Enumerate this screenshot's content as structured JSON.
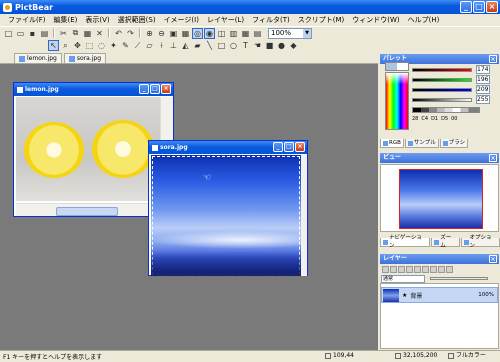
{
  "app": {
    "title": "PictBear"
  },
  "menu": [
    "ファイル(F)",
    "編集(E)",
    "表示(V)",
    "選択範囲(S)",
    "イメージ(I)",
    "レイヤー(L)",
    "フィルタ(T)",
    "スクリプト(M)",
    "ウィンドウ(W)",
    "ヘルプ(H)"
  ],
  "toolbar": {
    "zoom_value": "100%"
  },
  "tabs": [
    {
      "label": "lemon.jpg"
    },
    {
      "label": "sora.jpg"
    }
  ],
  "windows": {
    "lemon": {
      "title": "lemon.jpg"
    },
    "sora": {
      "title": "sora.jpg"
    }
  },
  "status": {
    "help_text": "F1 キーを押すとヘルプを表示します",
    "position": "109,44",
    "size": "32,105,200",
    "color_mode": "フルカラー"
  },
  "palette": {
    "title": "パレット",
    "rgb_values": [
      "174",
      "196",
      "209",
      "255"
    ],
    "hex_row": [
      "28",
      "C4",
      "D1",
      "D5",
      "00"
    ],
    "tabs": [
      "RGB",
      "サンプル",
      "ブラシ"
    ],
    "fg_color": "#aec4de"
  },
  "navigator": {
    "title": "ビュー",
    "tabs": [
      "ナビゲーション",
      "ズーム",
      "オプション"
    ]
  },
  "layers": {
    "title": "レイヤー",
    "mode": "通常",
    "items": [
      {
        "name": "背景",
        "opacity": "100%"
      }
    ]
  }
}
